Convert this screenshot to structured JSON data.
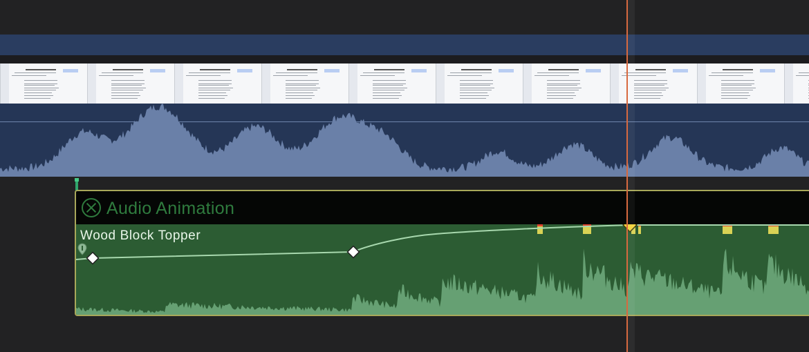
{
  "animation_editor": {
    "title": "Audio Animation",
    "close_icon": "close-circle-icon"
  },
  "audio_clip": {
    "name": "Wood Block Topper",
    "marker_icon": "marker-pin-icon",
    "volume_keyframes": [
      {
        "type": "normal"
      },
      {
        "type": "normal"
      },
      {
        "type": "selected"
      }
    ]
  },
  "video_clip": {
    "thumbnail_title": "Personal Revolution on this topic"
  },
  "colors": {
    "timeline_bg": "#222223",
    "video_clip": "#253656",
    "video_waveform": "#6a80a8",
    "audio_clip": "#2c5c33",
    "audio_waveform": "#66a073",
    "clip_border_selected": "#a9a85a",
    "keyframe_selected": "#f2d23c",
    "playhead": "#d8693f"
  }
}
